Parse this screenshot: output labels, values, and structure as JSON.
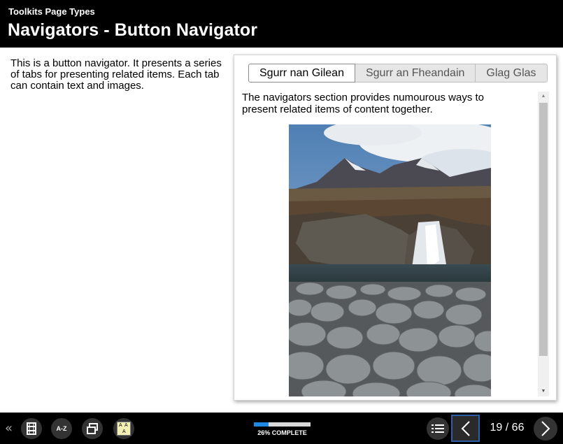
{
  "header": {
    "subtitle": "Toolkits Page Types",
    "title": "Navigators - Button Navigator"
  },
  "intro": {
    "text": "This is a button navigator. It presents a series of tabs for presenting related items. Each tab can contain text and images."
  },
  "navigator": {
    "tabs": [
      {
        "label": "Sgurr nan Gilean",
        "active": true
      },
      {
        "label": "Sgurr an Fheandain",
        "active": false
      },
      {
        "label": "Glag Glas",
        "active": false
      }
    ],
    "body_text": "The navigators section provides numourous ways to present related items of content together.",
    "image": "mountain-waterfall-photo"
  },
  "footer": {
    "progress_fraction": 0.26,
    "progress_label": "26% COMPLETE",
    "page_label": "19 / 66",
    "az_label": "A-Z",
    "font_size_glyphs": [
      "A",
      "A",
      "A"
    ],
    "icons": [
      "collapse-icon",
      "film-icon",
      "glossary-icon",
      "windows-icon",
      "text-size-icon",
      "menu-icon",
      "prev-arrow-icon",
      "next-arrow-icon"
    ]
  },
  "colors": {
    "header_bg": "#000000",
    "progress_fill": "#1e88e5",
    "prev_border": "#2e5ea8"
  }
}
